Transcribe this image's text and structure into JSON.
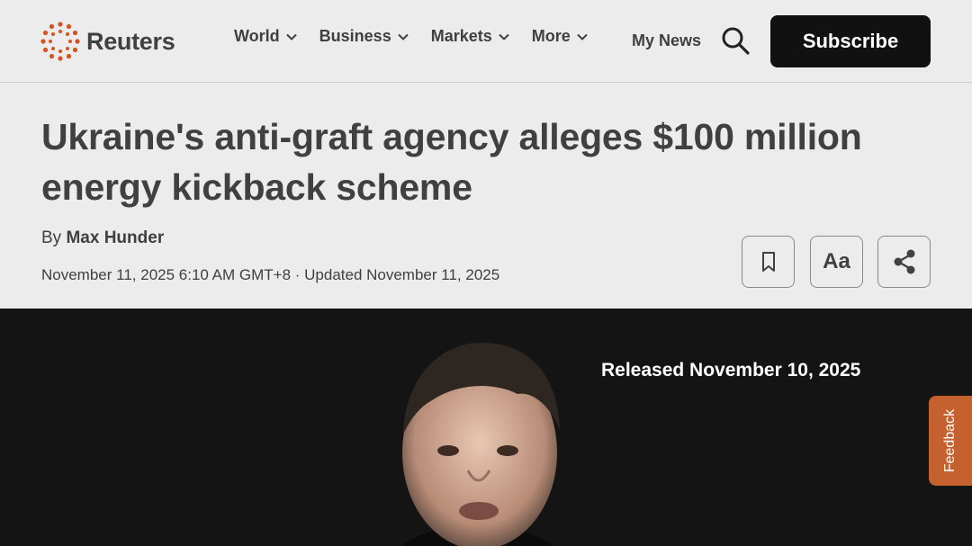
{
  "header": {
    "logo_text": "Reuters",
    "nav": [
      {
        "label": "World"
      },
      {
        "label": "Business"
      },
      {
        "label": "Markets"
      },
      {
        "label": "More"
      }
    ],
    "my_news": "My News",
    "subscribe": "Subscribe"
  },
  "article": {
    "headline": "Ukraine's anti-graft agency alleges $100 million energy kickback scheme",
    "by_prefix": "By",
    "author": "Max Hunder",
    "dateline": "November 11, 2025 6:10 AM GMT+8 · Updated November 11, 2025",
    "font_button": "Aa"
  },
  "video": {
    "caption": "Released November 10, 2025"
  },
  "feedback": "Feedback",
  "colors": {
    "brand_orange": "#d3541f",
    "feedback_bg": "#c5602f",
    "subscribe_bg": "#111111"
  },
  "icons": [
    "reuters-logo-icon",
    "chevron-down-icon",
    "search-icon",
    "bookmark-icon",
    "share-icon"
  ]
}
